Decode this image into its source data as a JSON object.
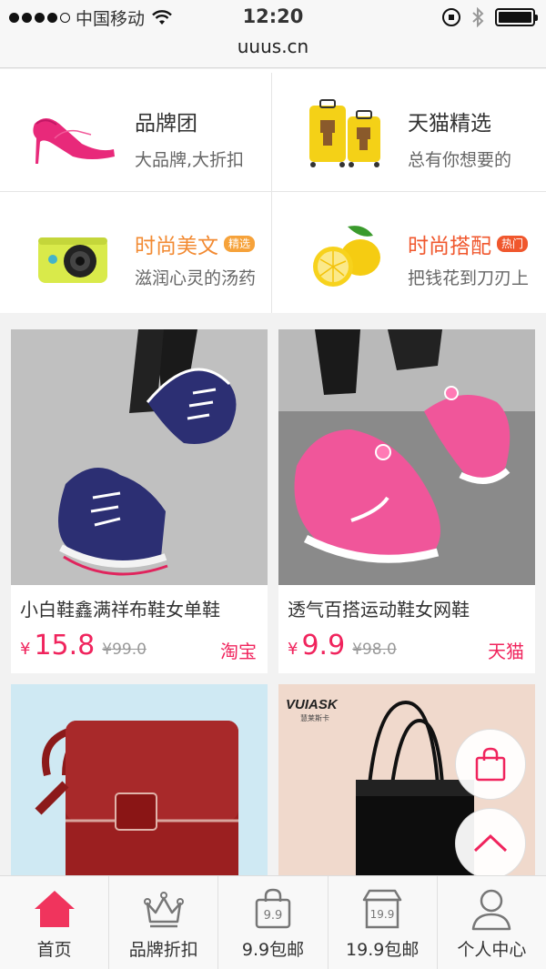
{
  "status_bar": {
    "carrier": "中国移动",
    "time": "12:20",
    "url": "uuus.cn"
  },
  "features": [
    {
      "title": "品牌团",
      "subtitle": "大品牌,大折扣",
      "tag": "",
      "image": "pink-high-heel"
    },
    {
      "title": "天猫精选",
      "subtitle": "总有你想要的",
      "tag": "",
      "image": "yellow-suitcases"
    },
    {
      "title": "时尚美文",
      "subtitle": "滋润心灵的汤药",
      "tag": "精选",
      "image": "action-camera"
    },
    {
      "title": "时尚搭配",
      "subtitle": "把钱花到刀刃上",
      "tag": "热门",
      "image": "lemons"
    }
  ],
  "products": [
    {
      "name": "小白鞋鑫满祥布鞋女单鞋",
      "currency": "¥",
      "price": "15.8",
      "old_price": "¥99.0",
      "shop": "淘宝",
      "image": "navy-canvas-shoes"
    },
    {
      "name": "透气百搭运动鞋女网鞋",
      "currency": "¥",
      "price": "9.9",
      "old_price": "¥98.0",
      "shop": "天猫",
      "image": "pink-mesh-sneakers"
    },
    {
      "name": "",
      "image": "red-leather-bag"
    },
    {
      "name": "",
      "brand_text": "VUIASK",
      "brand_sub": "慧莱斯卡",
      "image": "black-tote-bag"
    }
  ],
  "tabbar": [
    {
      "label": "首页",
      "icon": "home-icon",
      "active": true
    },
    {
      "label": "品牌折扣",
      "icon": "crown-icon"
    },
    {
      "label": "9.9包邮",
      "icon": "bag-9.9-icon",
      "icon_text": "9.9"
    },
    {
      "label": "19.9包邮",
      "icon": "shop-19.9-icon",
      "icon_text": "19.9"
    },
    {
      "label": "个人中心",
      "icon": "user-icon"
    }
  ],
  "colors": {
    "accent": "#f0245d",
    "orange_tag": "#f6a23a",
    "red_tag": "#f0572d"
  }
}
